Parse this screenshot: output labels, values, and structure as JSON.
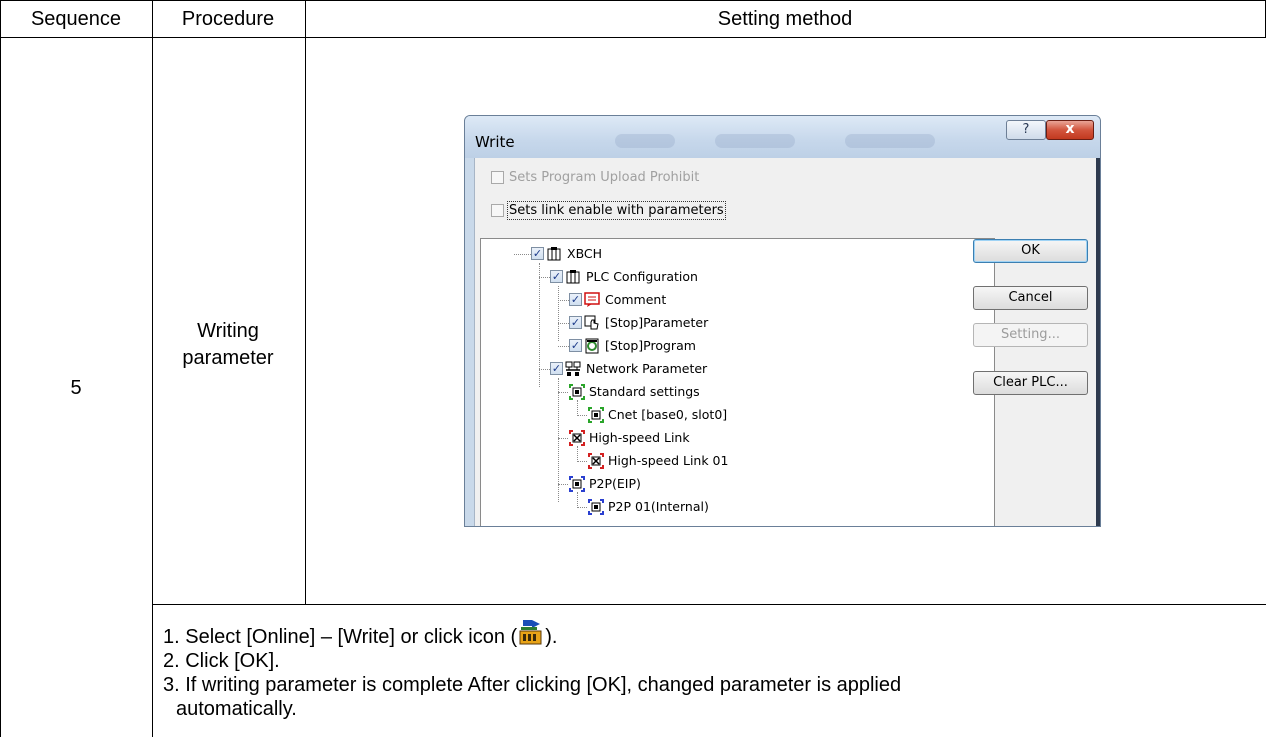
{
  "table": {
    "headers": {
      "sequence": "Sequence",
      "procedure": "Procedure",
      "setting_method": "Setting method"
    },
    "row": {
      "sequence": "5",
      "procedure_line1": "Writing",
      "procedure_line2": "parameter"
    },
    "notes": {
      "line1_before_icon": "1. Select [Online] – [Write] or click icon (",
      "line1_after_icon": ").",
      "line2": "2. Click [OK].",
      "line3": "3. If writing parameter is complete After clicking [OK], changed parameter is applied",
      "line4": "automatically."
    },
    "inline_icon": "write-to-plc-icon"
  },
  "dialog": {
    "title": "Write",
    "help_glyph": "?",
    "close_glyph": "x",
    "options": [
      {
        "label": "Sets Program Upload Prohibit",
        "checked": false,
        "enabled": false
      },
      {
        "label": "Sets link enable with parameters",
        "checked": false,
        "enabled": true
      }
    ],
    "tree": [
      {
        "label": "XBCH",
        "checked": true,
        "icon": "plc-cpu-icon"
      },
      {
        "label": "PLC Configuration",
        "checked": true,
        "icon": "plc-cpu-icon"
      },
      {
        "label": "Comment",
        "checked": true,
        "icon": "comment-icon"
      },
      {
        "label": "[Stop]Parameter",
        "checked": true,
        "icon": "parameter-hand-icon"
      },
      {
        "label": "[Stop]Program",
        "checked": true,
        "icon": "program-icon"
      },
      {
        "label": "Network Parameter",
        "checked": true,
        "icon": "network-icon"
      },
      {
        "label": "Standard settings",
        "icon": "standard-settings-icon"
      },
      {
        "label": "Cnet [base0, slot0]",
        "icon": "cnet-module-icon"
      },
      {
        "label": "High-speed Link",
        "icon": "high-speed-link-icon"
      },
      {
        "label": "High-speed Link 01",
        "icon": "high-speed-link-module-icon"
      },
      {
        "label": "P2P(EIP)",
        "icon": "p2p-icon"
      },
      {
        "label": "P2P 01(Internal)",
        "icon": "p2p-module-icon"
      }
    ],
    "buttons": {
      "ok": "OK",
      "cancel": "Cancel",
      "setting": "Setting...",
      "clear_plc": "Clear PLC..."
    },
    "colors": {
      "titlebar": "#c6d7eb",
      "close_button": "#c2391f",
      "standard_settings_marker": "#2aa52a",
      "high_speed_link_marker": "#d32020",
      "p2p_marker": "#2a3fd0"
    }
  }
}
